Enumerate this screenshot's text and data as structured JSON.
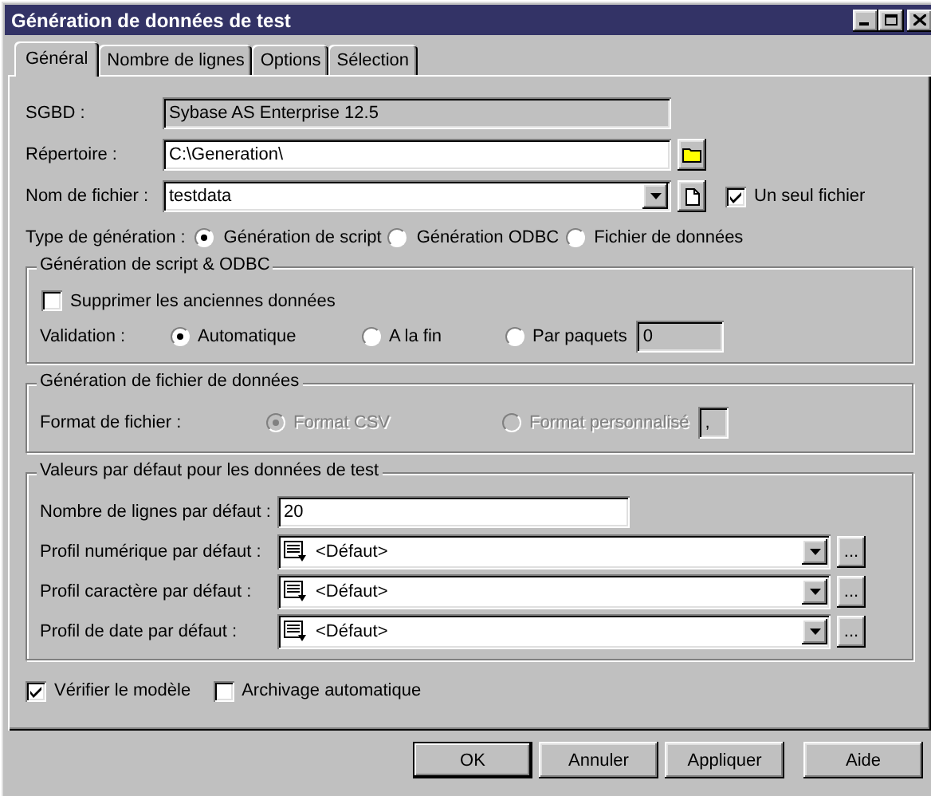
{
  "window": {
    "title": "Génération de données de test"
  },
  "tabs": [
    {
      "label": "Général",
      "selected": true
    },
    {
      "label": "Nombre de lignes",
      "selected": false
    },
    {
      "label": "Options",
      "selected": false
    },
    {
      "label": "Sélection",
      "selected": false
    }
  ],
  "general": {
    "rows": [
      {
        "kind": "text",
        "label": "SGBD :",
        "value": "Sybase AS Enterprise 12.5",
        "disabled": true
      },
      {
        "kind": "browse",
        "label": "Répertoire :",
        "value": "C:\\Generation\\",
        "disabled": false
      },
      {
        "kind": "combo",
        "label": "Nom de fichier :",
        "value": "testdata",
        "disabled": false,
        "checkbox": {
          "label": "Un seul fichier",
          "checked": true
        }
      }
    ],
    "generation_type": {
      "label": "Type de génération :",
      "options": [
        {
          "label": "Génération de script",
          "selected": true
        },
        {
          "label": "Génération ODBC",
          "selected": false
        },
        {
          "label": "Fichier de données",
          "selected": false
        }
      ]
    }
  },
  "script_group": {
    "title": "Génération de script & ODBC",
    "delete_old": {
      "label": "Supprimer les anciennes données",
      "checked": false
    },
    "validation": {
      "label": "Validation :",
      "options": [
        {
          "label": "Automatique",
          "selected": true
        },
        {
          "label": "A la fin",
          "selected": false
        },
        {
          "label": "Par paquets",
          "selected": false
        }
      ],
      "batch_value": "0",
      "batch_disabled": true
    }
  },
  "file_group": {
    "title": "Génération de fichier de données",
    "label": "Format de fichier :",
    "disabled": true,
    "options": [
      {
        "label": "Format CSV",
        "selected": true
      },
      {
        "label": "Format personnalisé",
        "selected": false
      }
    ],
    "separator": ","
  },
  "defaults_group": {
    "title": "Valeurs par défaut pour les données de test",
    "rows": [
      {
        "kind": "text",
        "label": "Nombre de lignes par défaut :",
        "value": "20"
      },
      {
        "kind": "profile",
        "label": "Profil numérique par défaut :",
        "value": "<Défaut>",
        "button": "..."
      },
      {
        "kind": "profile",
        "label": "Profil caractère par défaut :",
        "value": "<Défaut>",
        "button": "..."
      },
      {
        "kind": "profile",
        "label": "Profil de date par défaut :",
        "value": "<Défaut>",
        "button": "..."
      }
    ]
  },
  "options": [
    {
      "label": "Vérifier le modèle",
      "checked": true
    },
    {
      "label": "Archivage automatique",
      "checked": false
    }
  ],
  "buttons": [
    {
      "label": "OK",
      "default": true
    },
    {
      "label": "Annuler",
      "default": false
    },
    {
      "label": "Appliquer",
      "default": false
    },
    {
      "label": "Aide",
      "default": false
    }
  ]
}
